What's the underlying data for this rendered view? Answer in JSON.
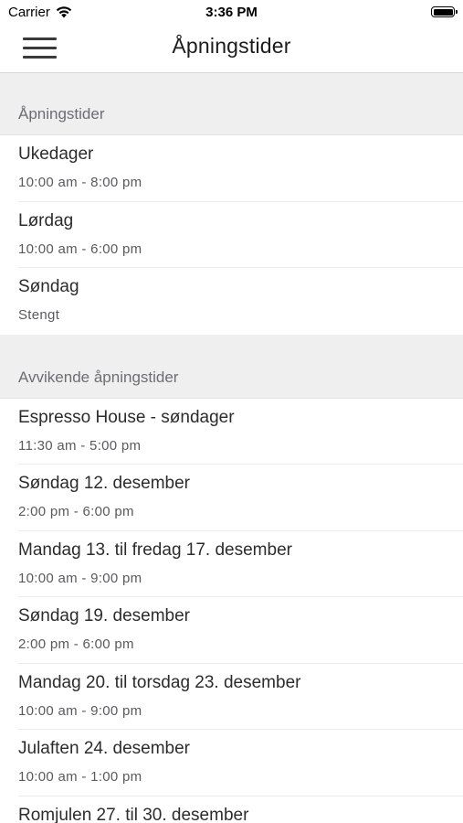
{
  "status_bar": {
    "carrier": "Carrier",
    "time": "3:36 PM",
    "icons": [
      "wifi-icon",
      "battery-icon"
    ]
  },
  "nav": {
    "title": "Åpningstider",
    "menu_icon": "hamburger-menu-icon"
  },
  "regular": {
    "header": "Åpningstider",
    "items": [
      {
        "title": "Ukedager",
        "hours": "10:00 am - 8:00 pm"
      },
      {
        "title": "Lørdag",
        "hours": "10:00 am - 6:00 pm"
      },
      {
        "title": "Søndag",
        "hours": "Stengt"
      }
    ]
  },
  "special": {
    "header": "Avvikende åpningstider",
    "items": [
      {
        "title": "Espresso House - søndager",
        "hours": "11:30 am - 5:00 pm"
      },
      {
        "title": "Søndag 12. desember",
        "hours": "2:00 pm - 6:00 pm"
      },
      {
        "title": "Mandag 13. til fredag 17. desember",
        "hours": "10:00 am - 9:00 pm"
      },
      {
        "title": "Søndag 19. desember",
        "hours": "2:00 pm - 6:00 pm"
      },
      {
        "title": "Mandag 20. til torsdag 23. desember",
        "hours": "10:00 am - 9:00 pm"
      },
      {
        "title": "Julaften 24. desember",
        "hours": "10:00 am - 1:00 pm"
      },
      {
        "title": "Romjulen 27. til 30. desember",
        "hours": ""
      }
    ]
  }
}
